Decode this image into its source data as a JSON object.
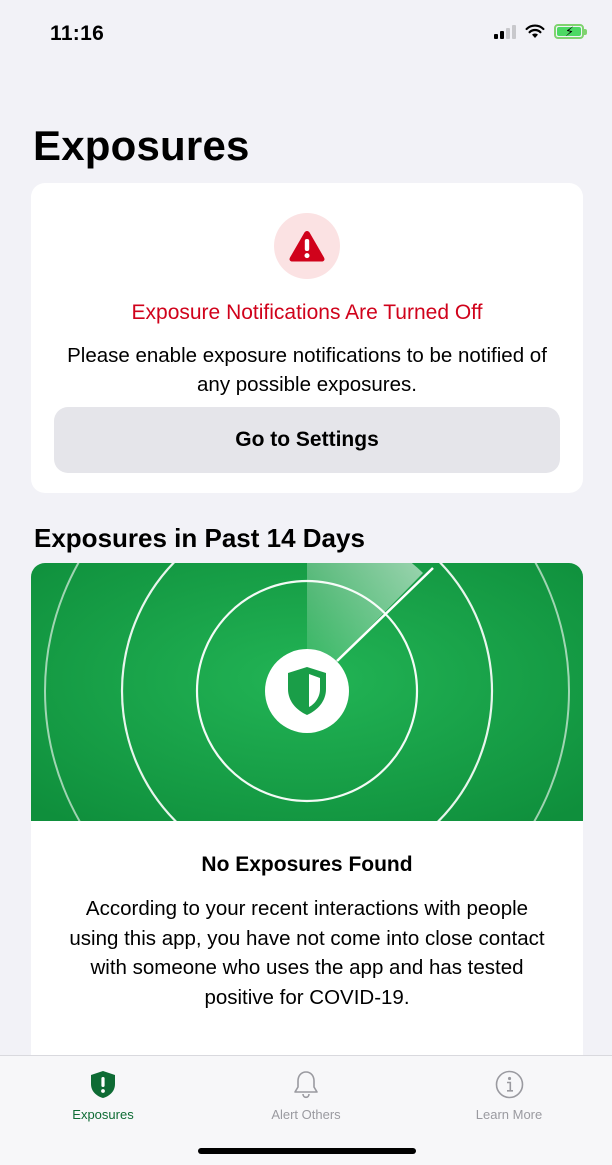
{
  "status_bar": {
    "time": "11:16"
  },
  "page": {
    "title": "Exposures"
  },
  "alert_card": {
    "icon": "warning-icon",
    "title": "Exposure Notifications Are Turned Off",
    "body": "Please enable exposure notifications to be notified of any possible exposures.",
    "button_label": "Go to Settings"
  },
  "exposures_section": {
    "title": "Exposures in Past 14 Days",
    "status_title": "No Exposures Found",
    "status_body": "According to your recent interactions with people using this app, you have not come into close contact with someone who uses the app and has tested positive for COVID-19."
  },
  "tab_bar": {
    "tabs": [
      {
        "label": "Exposures",
        "icon": "shield-icon",
        "active": true
      },
      {
        "label": "Alert Others",
        "icon": "bell-icon",
        "active": false
      },
      {
        "label": "Learn More",
        "icon": "info-icon",
        "active": false
      }
    ]
  },
  "colors": {
    "accent_green": "#0e6b34",
    "radar_green": "#1fae4f",
    "alert_red": "#d0021b",
    "background": "#f2f2f7"
  }
}
